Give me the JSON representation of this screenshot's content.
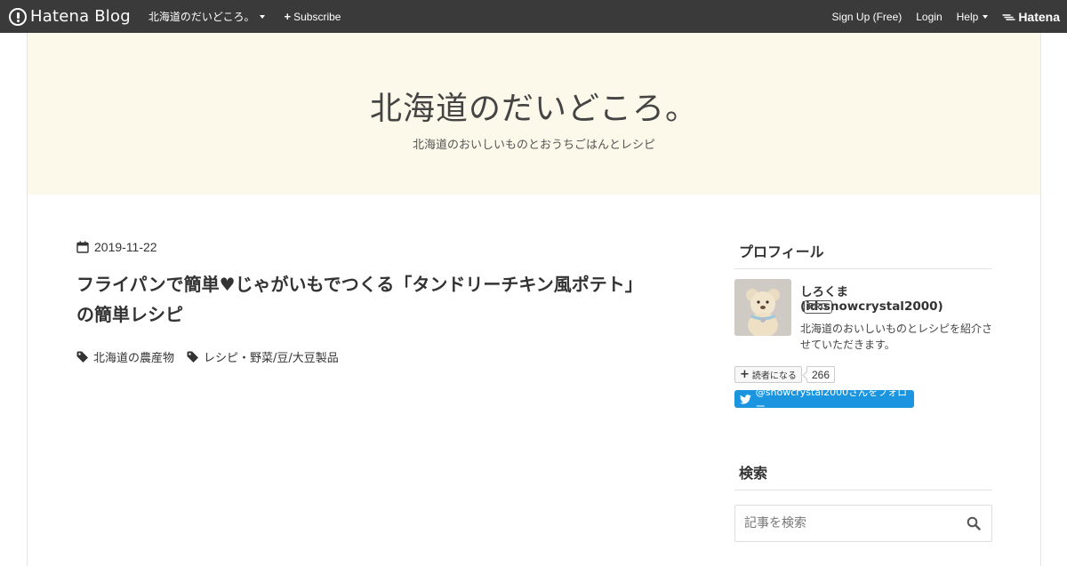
{
  "navbar": {
    "brand": "Hatena Blog",
    "blog_name": "北海道のだいどころ。",
    "subscribe_label": "Subscribe",
    "signup_label": "Sign Up (Free)",
    "login_label": "Login",
    "help_label": "Help",
    "hatena_label": "Hatena"
  },
  "header": {
    "title": "北海道のだいどころ。",
    "description": "北海道のおいしいものとおうちごはんとレシピ"
  },
  "entry": {
    "date": "2019-11-22",
    "title": "フライパンで簡単♥じゃがいもでつくる「タンドリーチキン風ポテト」の簡単レシピ",
    "categories": [
      "北海道の農産物",
      "レシピ・野菜/豆/大豆製品"
    ]
  },
  "sidebar": {
    "profile": {
      "title": "プロフィール",
      "name": "しろくま (id:snowcrystal2000)",
      "badge": "PRO",
      "description": "北海道のおいしいものとレシピを紹介させていただきます。",
      "subscribe_label": "読者になる",
      "subscriber_count": "266",
      "twitter_follow": "@snowcrystal2000さんをフォロー"
    },
    "search": {
      "title": "検索",
      "placeholder": "記事を検索"
    }
  },
  "colors": {
    "navbar_bg": "#3a3a3a",
    "header_bg": "#fdf9ea",
    "twitter_blue": "#1b95e0"
  }
}
